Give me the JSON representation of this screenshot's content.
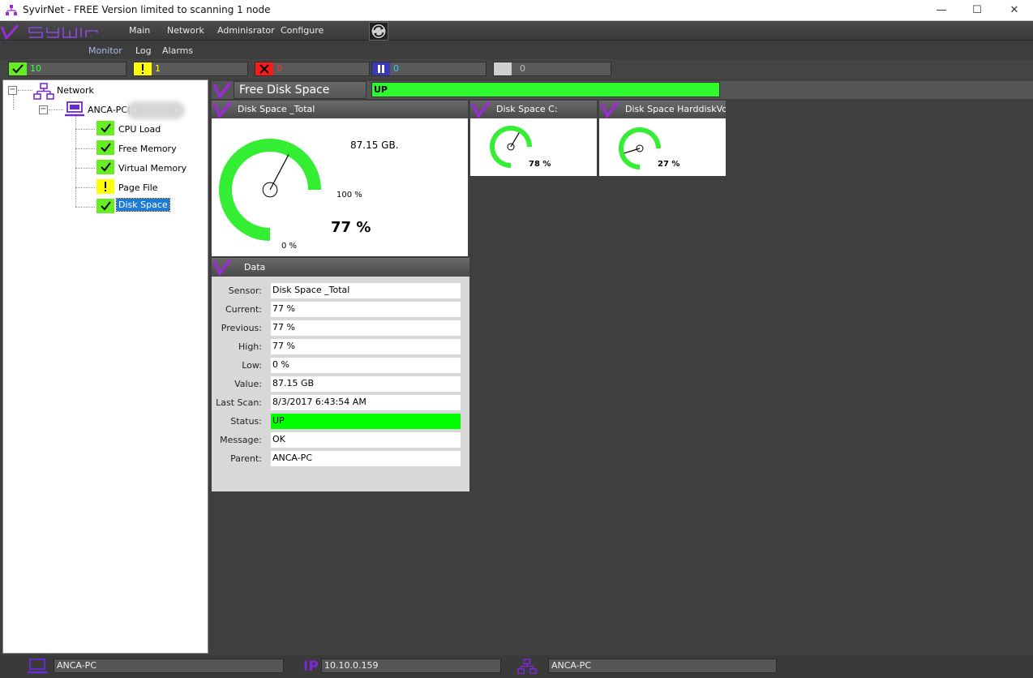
{
  "window": {
    "title": "SyvirNet - FREE Version limited to scanning 1 node",
    "minimize": "—",
    "maximize": "☐",
    "close": "✕"
  },
  "menu": {
    "items": [
      "Main",
      "Network",
      "Adminisrator",
      "Configure"
    ],
    "sub_items": [
      "Monitor",
      "Log",
      "Alarms"
    ]
  },
  "counters": [
    {
      "icon": "check-icon",
      "value": "10",
      "color": "#3dff3d"
    },
    {
      "icon": "warning-icon",
      "value": "1",
      "color": "#ffff00"
    },
    {
      "icon": "error-icon",
      "value": "0",
      "color": "#ff2020"
    },
    {
      "icon": "pause-icon",
      "value": "0",
      "color": "#33ccff"
    },
    {
      "icon": "unknown-icon",
      "value": "0",
      "color": "#bbbbbb"
    }
  ],
  "tree": {
    "root": "Network",
    "node": "ANCA-PC(",
    "sensors": [
      {
        "label": "CPU Load",
        "status": "ok"
      },
      {
        "label": "Free Memory",
        "status": "ok"
      },
      {
        "label": "Virtual Memory",
        "status": "ok"
      },
      {
        "label": "Page File",
        "status": "warn"
      },
      {
        "label": "Disk Space",
        "status": "ok",
        "selected": true
      }
    ]
  },
  "sensor": {
    "title": "Free Disk Space",
    "status": "UP"
  },
  "gauges": [
    {
      "title": "Disk Space _Total",
      "value_text": "87.15 GB.",
      "max_label": "100 %",
      "min_label": "0 %",
      "percent_label": "77 %",
      "percent": 77
    },
    {
      "title": "Disk Space C:",
      "percent_label": "78 %",
      "percent": 78
    },
    {
      "title": "Disk Space HarddiskVolume",
      "percent_label": "27 %",
      "percent": 27
    }
  ],
  "data": {
    "title": "Data",
    "rows": [
      {
        "label": "Sensor:",
        "value": "Disk Space _Total"
      },
      {
        "label": "Current:",
        "value": "77 %"
      },
      {
        "label": "Previous:",
        "value": "77 %"
      },
      {
        "label": "High:",
        "value": "77 %"
      },
      {
        "label": "Low:",
        "value": "0 %"
      },
      {
        "label": "Value:",
        "value": "87.15 GB"
      },
      {
        "label": "Last Scan:",
        "value": "8/3/2017 6:43:54 AM"
      },
      {
        "label": "Status:",
        "value": "UP"
      },
      {
        "label": "Message:",
        "value": "OK"
      },
      {
        "label": "Parent:",
        "value": "ANCA-PC"
      }
    ]
  },
  "statusbar": {
    "host": "ANCA-PC",
    "ip_label": "IP",
    "ip": "10.10.0.159",
    "network": "ANCA-PC"
  },
  "colors": {
    "ok": "#66ee22",
    "warn": "#ffff00",
    "gauge_green": "#33ee33",
    "accent_purple": "#8a2be2"
  }
}
